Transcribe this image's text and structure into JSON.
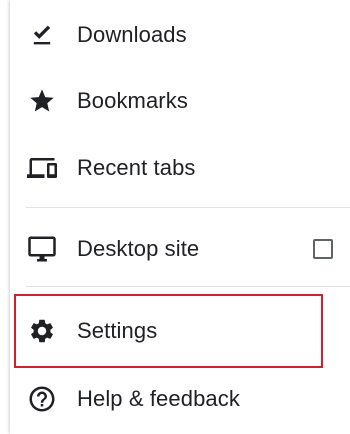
{
  "menu": {
    "items": [
      {
        "label": "Downloads",
        "icon": "download-done-icon"
      },
      {
        "label": "Bookmarks",
        "icon": "star-icon"
      },
      {
        "label": "Recent tabs",
        "icon": "devices-icon"
      },
      {
        "label": "Desktop site",
        "icon": "desktop-icon",
        "checkbox_checked": false
      },
      {
        "label": "Settings",
        "icon": "gear-icon",
        "highlighted": true
      },
      {
        "label": "Help & feedback",
        "icon": "help-icon"
      }
    ]
  },
  "colors": {
    "icon": "#202124",
    "text": "#202124",
    "divider": "#e3e3e3",
    "highlight_border": "#d21f2b"
  }
}
